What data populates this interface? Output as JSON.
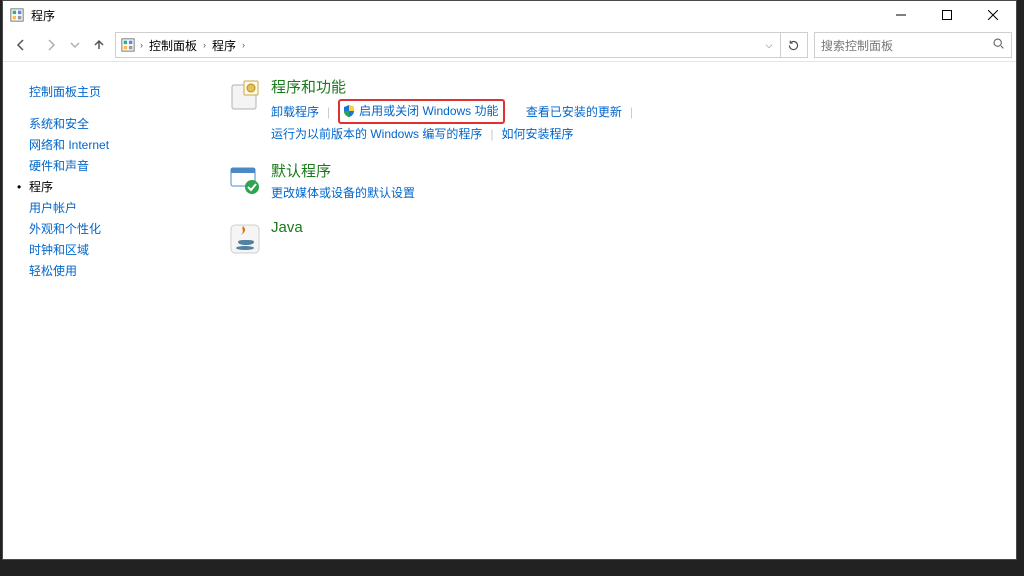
{
  "window": {
    "title": "程序"
  },
  "nav": {
    "breadcrumbs": [
      "控制面板",
      "程序"
    ],
    "search_placeholder": "搜索控制面板"
  },
  "sidebar": {
    "home": "控制面板主页",
    "items": [
      {
        "label": "系统和安全",
        "current": false
      },
      {
        "label": "网络和 Internet",
        "current": false
      },
      {
        "label": "硬件和声音",
        "current": false
      },
      {
        "label": "程序",
        "current": true
      },
      {
        "label": "用户帐户",
        "current": false
      },
      {
        "label": "外观和个性化",
        "current": false
      },
      {
        "label": "时钟和区域",
        "current": false
      },
      {
        "label": "轻松使用",
        "current": false
      }
    ]
  },
  "content": {
    "categories": [
      {
        "id": "programs-features",
        "title": "程序和功能",
        "links_row1": [
          {
            "label": "卸载程序",
            "shield": false,
            "highlight": false
          },
          {
            "label": "启用或关闭 Windows 功能",
            "shield": true,
            "highlight": true
          },
          {
            "label": "查看已安装的更新",
            "shield": false,
            "highlight": false
          }
        ],
        "links_row2": [
          {
            "label": "运行为以前版本的 Windows 编写的程序",
            "shield": false
          },
          {
            "label": "如何安装程序",
            "shield": false
          }
        ]
      },
      {
        "id": "default-programs",
        "title": "默认程序",
        "links_row1": [
          {
            "label": "更改媒体或设备的默认设置",
            "shield": false
          }
        ]
      },
      {
        "id": "java",
        "title": "Java",
        "links_row1": []
      }
    ]
  }
}
